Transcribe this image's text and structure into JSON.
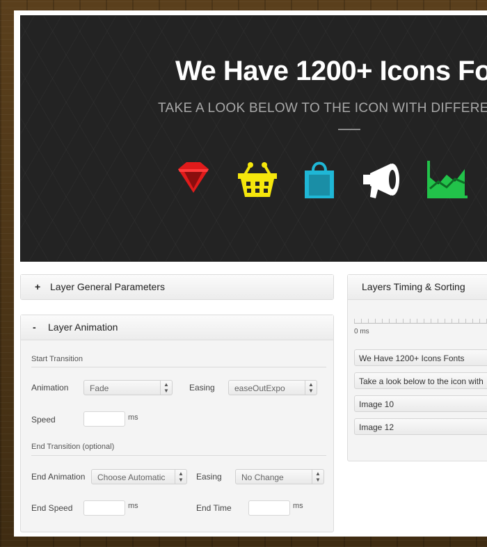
{
  "hero": {
    "title": "We Have 1200+ Icons Fo",
    "subtitle": "TAKE A LOOK BELOW TO THE ICON WITH DIFFERENT",
    "icons": [
      {
        "name": "ruby-gem-icon",
        "color": "#e01b1b"
      },
      {
        "name": "shopping-basket-icon",
        "color": "#f5e60c"
      },
      {
        "name": "shopping-bag-icon",
        "color": "#1fb7d6"
      },
      {
        "name": "megaphone-icon",
        "color": "#ffffff"
      },
      {
        "name": "area-chart-icon",
        "color": "#22c34a"
      }
    ]
  },
  "general_panel": {
    "symbol": "+",
    "title": "Layer General Parameters"
  },
  "animation_panel": {
    "symbol": "-",
    "title": "Layer Animation",
    "start_section": "Start Transition",
    "animation_label": "Animation",
    "animation_value": "Fade",
    "easing_label": "Easing",
    "easing_value": "easeOutExpo",
    "speed_label": "Speed",
    "speed_unit": "ms",
    "end_section": "End Transition (optional)",
    "end_animation_label": "End Animation",
    "end_animation_value": "Choose Automatic",
    "end_easing_label": "Easing",
    "end_easing_value": "No Change",
    "end_speed_label": "End Speed",
    "end_speed_unit": "ms",
    "end_time_label": "End Time",
    "end_time_unit": "ms"
  },
  "timing_panel": {
    "title": "Layers Timing & Sorting",
    "zero_label": "0 ms",
    "layers": [
      "We Have 1200+ Icons Fonts",
      "Take a look below to the icon with",
      "Image 10",
      "Image 12"
    ]
  }
}
